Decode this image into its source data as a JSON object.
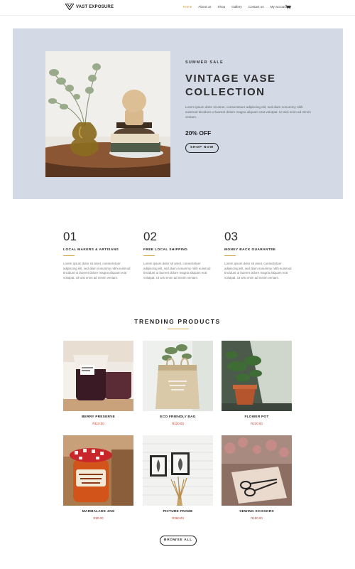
{
  "header": {
    "logo_text": "VAST EXPOSURE",
    "nav": [
      {
        "label": "Home",
        "active": true
      },
      {
        "label": "About us",
        "active": false
      },
      {
        "label": "Shop",
        "active": false
      },
      {
        "label": "Gallery",
        "active": false
      },
      {
        "label": "Contact us",
        "active": false
      },
      {
        "label": "My account",
        "active": false
      }
    ],
    "cart_icon": "cart-icon",
    "accent_color": "#c99a2e"
  },
  "hero": {
    "eyebrow": "SUMMER SALE",
    "title": "VINTAGE VASE COLLECTION",
    "body": "Lorem ipsum dolor sit amet, consectetuer adipiscing elit, sed diam nonummy nibh euismod tincidunt ut laoreet dolore magna aliquam erat volutpat. Ut wisi enim ad minim veniam.",
    "discount": "20% OFF",
    "cta": "SHOP NOW",
    "background": "#d3dae6"
  },
  "features": [
    {
      "number": "01",
      "title": "LOCAL MAKERS & ARTISANS",
      "body": "Lorem ipsum dolor sit amet, consectetuer adipiscing elit, sed diam nonummy nibh euismod tincidunt ut laoreet dolore magna aliquam erat volutpat. Ut wisi enim ad minim veniam."
    },
    {
      "number": "02",
      "title": "FREE LOCAL SHIPPING",
      "body": "Lorem ipsum dolor sit amet, consectetuer adipiscing elit, sed diam nonummy nibh euismod tincidunt ut laoreet dolore magna aliquam erat volutpat. Ut wisi enim ad minim veniam."
    },
    {
      "number": "03",
      "title": "MONEY BACK GUARANTEE",
      "body": "Lorem ipsum dolor sit amet, consectetuer adipiscing elit, sed diam nonummy nibh euismod tincidunt ut laoreet dolore magna aliquam erat volutpat. Ut wisi enim ad minim veniam."
    }
  ],
  "trending": {
    "title": "TRENDING PRODUCTS",
    "products": [
      {
        "name": "BERRY PRESERVE",
        "price": "R110.00"
      },
      {
        "name": "ECO FRIENDLY BAG",
        "price": "R120.00"
      },
      {
        "name": "FLOWER POT",
        "price": "R220.00"
      },
      {
        "name": "MARMALADE JAM",
        "price": "R80.00"
      },
      {
        "name": "PICTURE FRAME",
        "price": "R360.00"
      },
      {
        "name": "SEWING SCISSORS",
        "price": "R150.00"
      }
    ],
    "browse_label": "BROWSE ALL",
    "price_color": "#c0412d"
  }
}
